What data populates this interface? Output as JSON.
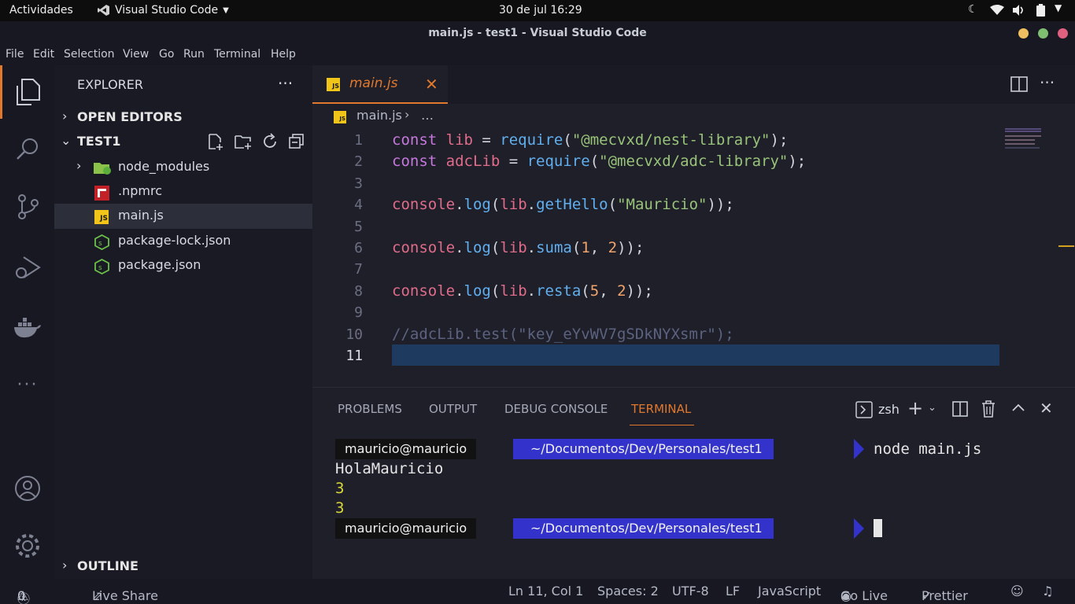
{
  "gnome": {
    "activities": "Actividades",
    "app": "Visual Studio Code",
    "date": "30 de jul",
    "time": "16:29"
  },
  "window": {
    "title": "main.js - test1 - Visual Studio Code"
  },
  "menu": [
    "File",
    "Edit",
    "Selection",
    "View",
    "Go",
    "Run",
    "Terminal",
    "Help"
  ],
  "sidebar": {
    "title": "EXPLORER",
    "open_editors": "OPEN EDITORS",
    "folder": "TEST1",
    "files": [
      {
        "name": "node_modules",
        "icon": "folder-icon"
      },
      {
        "name": ".npmrc",
        "icon": "npm-icon"
      },
      {
        "name": "main.js",
        "icon": "js-icon"
      },
      {
        "name": "package-lock.json",
        "icon": "nodejs-icon"
      },
      {
        "name": "package.json",
        "icon": "nodejs-icon"
      }
    ],
    "outline": "OUTLINE"
  },
  "editor": {
    "tab": "main.js",
    "breadcrumb_file": "main.js",
    "breadcrumb_more": "…",
    "active_line": 11,
    "lines": [
      [
        [
          "kw",
          "const "
        ],
        [
          "vr",
          "lib"
        ],
        [
          "pu",
          " = "
        ],
        [
          "fn",
          "require"
        ],
        [
          "pu",
          "("
        ],
        [
          "st",
          "\"@mecvxd/nest-library\""
        ],
        [
          "pu",
          ");"
        ]
      ],
      [
        [
          "kw",
          "const "
        ],
        [
          "vr",
          "adcLib"
        ],
        [
          "pu",
          " = "
        ],
        [
          "fn",
          "require"
        ],
        [
          "pu",
          "("
        ],
        [
          "st",
          "\"@mecvxd/adc-library\""
        ],
        [
          "pu",
          ");"
        ]
      ],
      [],
      [
        [
          "vr",
          "console"
        ],
        [
          "pu",
          "."
        ],
        [
          "fn",
          "log"
        ],
        [
          "pu",
          "("
        ],
        [
          "vr",
          "lib"
        ],
        [
          "pu",
          "."
        ],
        [
          "fn",
          "getHello"
        ],
        [
          "pu",
          "("
        ],
        [
          "st",
          "\"Mauricio\""
        ],
        [
          "pu",
          "));"
        ]
      ],
      [],
      [
        [
          "vr",
          "console"
        ],
        [
          "pu",
          "."
        ],
        [
          "fn",
          "log"
        ],
        [
          "pu",
          "("
        ],
        [
          "vr",
          "lib"
        ],
        [
          "pu",
          "."
        ],
        [
          "fn",
          "suma"
        ],
        [
          "pu",
          "("
        ],
        [
          "nm",
          "1"
        ],
        [
          "pu",
          ", "
        ],
        [
          "nm",
          "2"
        ],
        [
          "pu",
          "));"
        ]
      ],
      [],
      [
        [
          "vr",
          "console"
        ],
        [
          "pu",
          "."
        ],
        [
          "fn",
          "log"
        ],
        [
          "pu",
          "("
        ],
        [
          "vr",
          "lib"
        ],
        [
          "pu",
          "."
        ],
        [
          "fn",
          "resta"
        ],
        [
          "pu",
          "("
        ],
        [
          "nm",
          "5"
        ],
        [
          "pu",
          ", "
        ],
        [
          "nm",
          "2"
        ],
        [
          "pu",
          "));"
        ]
      ],
      [],
      [
        [
          "cm",
          "//adcLib.test(\"key_eYvWV7gSDkNYXsmr\");"
        ]
      ],
      []
    ]
  },
  "panel": {
    "tabs": [
      "PROBLEMS",
      "OUTPUT",
      "DEBUG CONSOLE",
      "TERMINAL"
    ],
    "active_tab": "TERMINAL",
    "shell": "zsh",
    "prompt_user": "mauricio@mauricio",
    "prompt_path": "~/Documentos/Dev/Personales/test1",
    "command": "node main.js",
    "output": [
      "HolaMauricio",
      "3",
      "3"
    ]
  },
  "status": {
    "errors": "0",
    "warnings": "0",
    "live_share": "Live Share",
    "position": "Ln 11, Col 1",
    "spaces": "Spaces: 2",
    "encoding": "UTF-8",
    "eol": "LF",
    "language": "JavaScript",
    "go_live": "Go Live",
    "prettier": "Prettier"
  },
  "colors": {
    "accent": "#e0782e",
    "prompt_path_bg": "#3333cc",
    "activity_bg": "#171821",
    "editor_bg": "#1e1f29"
  }
}
